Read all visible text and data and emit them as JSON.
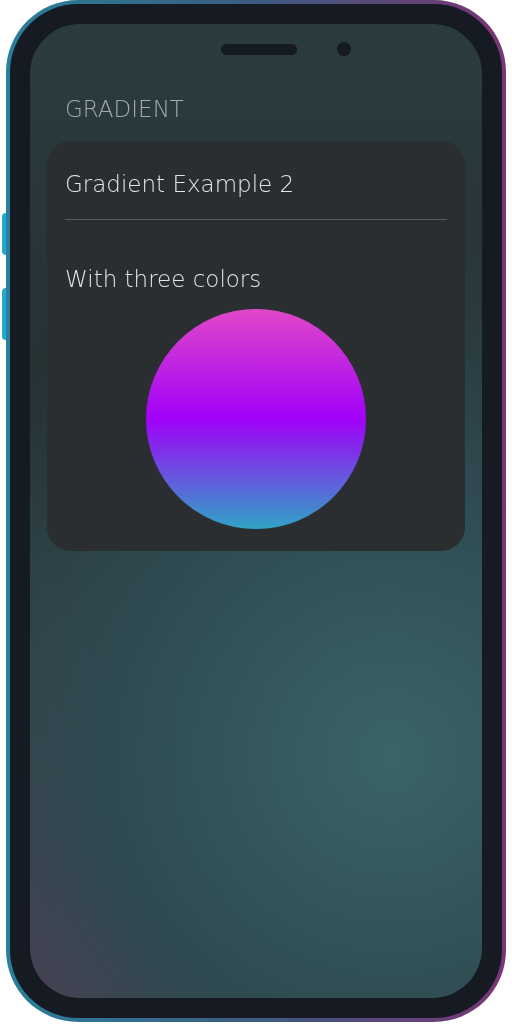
{
  "section": {
    "title": "GRADIENT"
  },
  "card": {
    "title": "Gradient Example 2",
    "subtitle": "With three colors"
  }
}
